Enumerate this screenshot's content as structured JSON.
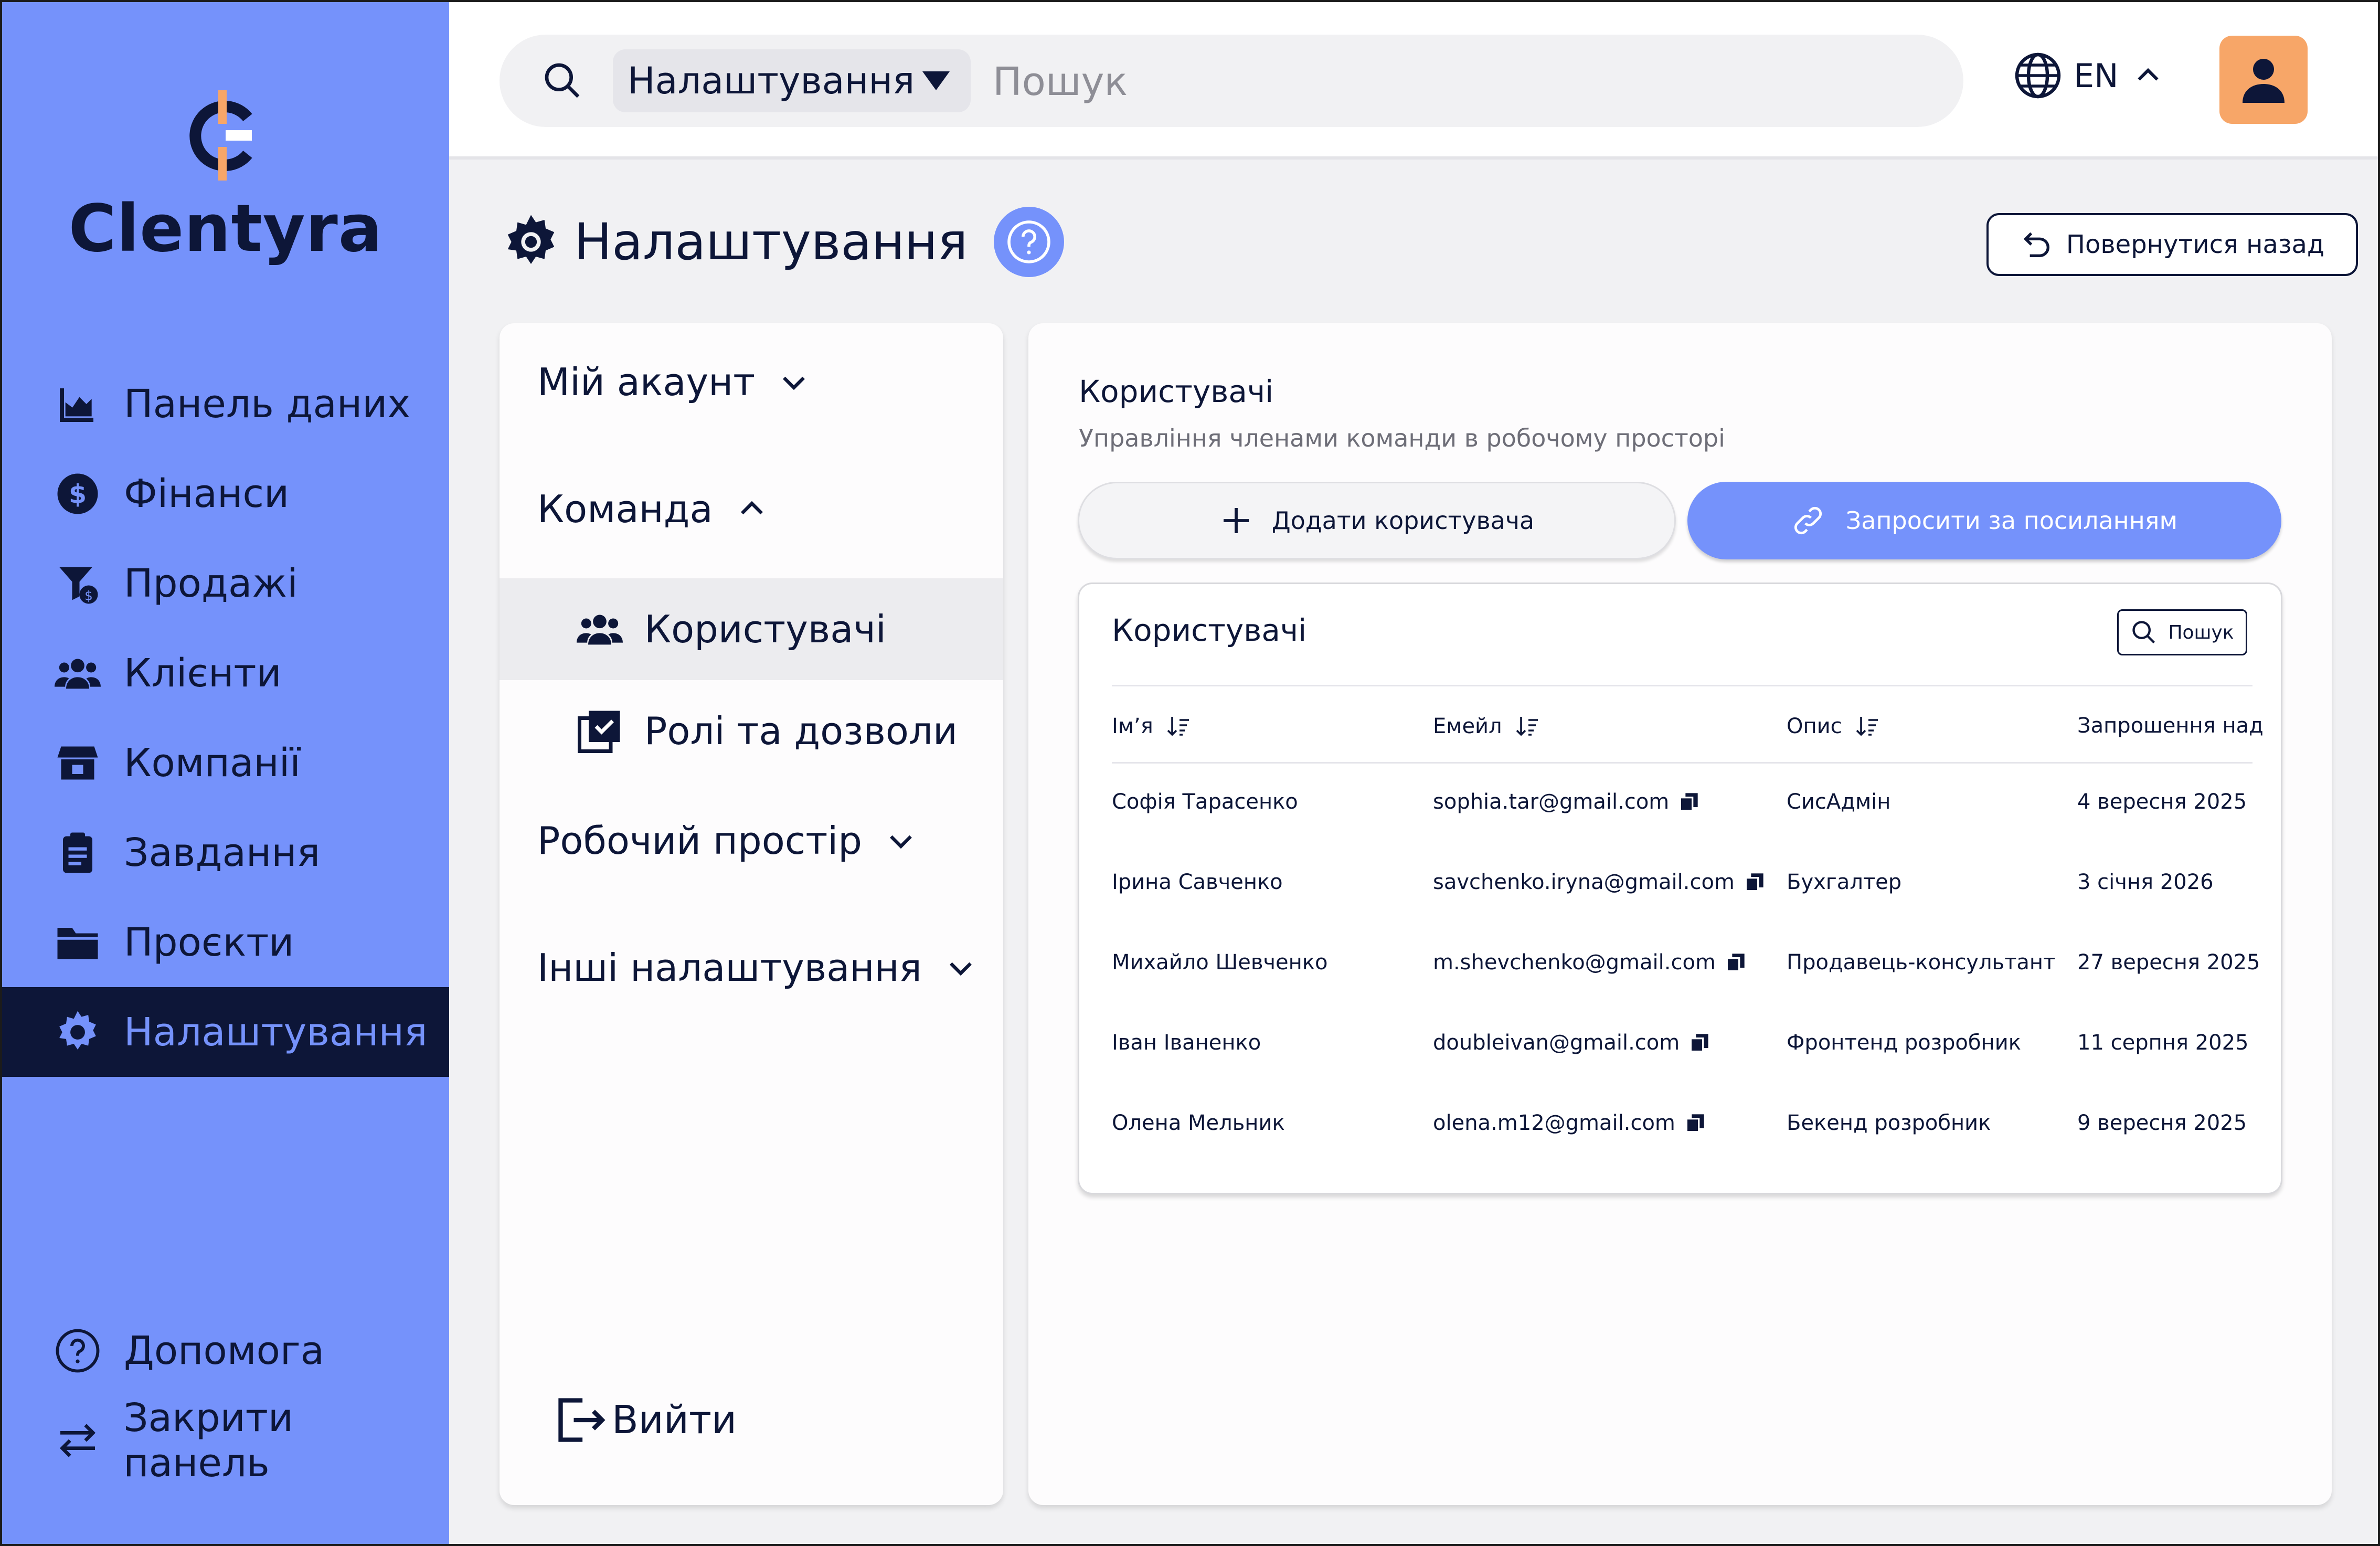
{
  "app": {
    "name": "Clentyra",
    "colors": {
      "sidebar": "#7592fb",
      "accent": "#7592fb",
      "navy": "#0d1638",
      "avatar": "#f7a668",
      "logo_orange": "#f7a668"
    }
  },
  "sidebar": {
    "items": [
      {
        "label": "Панель даних",
        "icon": "chart-area-icon",
        "active": false
      },
      {
        "label": "Фінанси",
        "icon": "dollar-coin-icon",
        "active": false
      },
      {
        "label": "Продажі",
        "icon": "funnel-dollar-icon",
        "active": false
      },
      {
        "label": "Клієнти",
        "icon": "users-icon",
        "active": false
      },
      {
        "label": "Компанії",
        "icon": "store-icon",
        "active": false
      },
      {
        "label": "Завдання",
        "icon": "clipboard-list-icon",
        "active": false
      },
      {
        "label": "Проєкти",
        "icon": "folder-icon",
        "active": false
      },
      {
        "label": "Налаштування",
        "icon": "gear-icon",
        "active": true
      }
    ],
    "bottom": [
      {
        "label": "Допомога",
        "icon": "question-circle-icon"
      },
      {
        "label": "Закрити панель",
        "icon": "swap-arrows-icon"
      }
    ]
  },
  "topbar": {
    "search_scope": "Налаштування",
    "search_placeholder": "Пошук",
    "language": "EN"
  },
  "page": {
    "title": "Налаштування",
    "back_button": "Повернутися назад"
  },
  "settings_nav": {
    "sections": [
      {
        "label": "Мій акаунт",
        "expanded": false
      },
      {
        "label": "Команда",
        "expanded": true
      },
      {
        "label": "Робочий простір",
        "expanded": false
      },
      {
        "label": "Інші налаштування",
        "expanded": false
      }
    ],
    "team_items": [
      {
        "label": "Користувачі",
        "icon": "users-icon",
        "active": true
      },
      {
        "label": "Ролі та дозволи",
        "icon": "checkbox-stack-icon",
        "active": false
      }
    ],
    "logout": "Вийти"
  },
  "main": {
    "title": "Користувачі",
    "subtitle": "Управління членами команди в робочому просторі",
    "add_user": "Додати користувача",
    "invite_link": "Запросити за посиланням",
    "table": {
      "title": "Користувачі",
      "search_label": "Пошук",
      "columns": [
        "Ім’я",
        "Емейл",
        "Опис",
        "Запрошення над"
      ],
      "rows": [
        [
          "Софія Тарасенко",
          "sophia.tar@gmail.com",
          "СисАдмін",
          "4 вересня 2025"
        ],
        [
          "Ірина Савченко",
          "savchenko.iryna@gmail.com",
          "Бухгалтер",
          "3 січня 2026"
        ],
        [
          "Михайло Шевченко",
          "m.shevchenko@gmail.com",
          "Продавець-консультант",
          "27 вересня 2025"
        ],
        [
          "Іван Іваненко",
          "doubleivan@gmail.com",
          "Фронтенд розробник",
          "11 серпня 2025"
        ],
        [
          "Олена Мельник",
          "olena.m12@gmail.com",
          "Бекенд розробник",
          "9 вересня 2025"
        ]
      ]
    }
  }
}
